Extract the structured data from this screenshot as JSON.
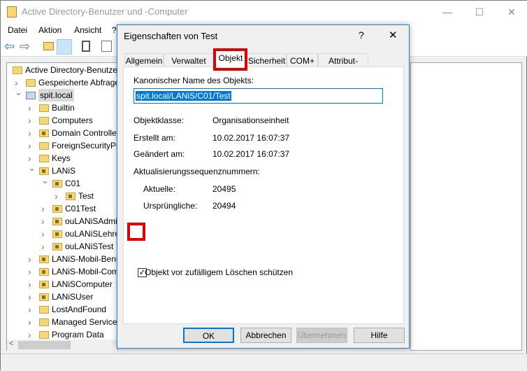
{
  "window": {
    "title": "Active Directory-Benutzer und -Computer",
    "minimize": "—",
    "maximize": "☐",
    "close": "✕"
  },
  "menu": [
    "Datei",
    "Aktion",
    "Ansicht",
    "?"
  ],
  "tree": [
    {
      "label": "Active Directory-Benutzer",
      "level": 0,
      "chev": "",
      "icon": "snapin"
    },
    {
      "label": "Gespeicherte Abfragen",
      "level": 1,
      "chev": ">",
      "icon": "folder"
    },
    {
      "label": "spit.local",
      "level": 1,
      "chev": "v",
      "icon": "domain"
    },
    {
      "label": "Builtin",
      "level": 2,
      "chev": ">",
      "icon": "folder"
    },
    {
      "label": "Computers",
      "level": 2,
      "chev": ">",
      "icon": "folder"
    },
    {
      "label": "Domain Controllers",
      "level": 2,
      "chev": ">",
      "icon": "ou"
    },
    {
      "label": "ForeignSecurityPrincipals",
      "level": 2,
      "chev": ">",
      "icon": "folder"
    },
    {
      "label": "Keys",
      "level": 2,
      "chev": ">",
      "icon": "folder"
    },
    {
      "label": "LANiS",
      "level": 2,
      "chev": "v",
      "icon": "ou"
    },
    {
      "label": "C01",
      "level": 3,
      "chev": "v",
      "icon": "ou"
    },
    {
      "label": "Test",
      "level": 4,
      "chev": ">",
      "icon": "ou"
    },
    {
      "label": "C01Test",
      "level": 3,
      "chev": ">",
      "icon": "ou"
    },
    {
      "label": "ouLANiSAdmin",
      "level": 3,
      "chev": ">",
      "icon": "ou"
    },
    {
      "label": "ouLANiSLehrer",
      "level": 3,
      "chev": ">",
      "icon": "ou"
    },
    {
      "label": "ouLANiSTest",
      "level": 3,
      "chev": ">",
      "icon": "ou"
    },
    {
      "label": "LANiS-Mobil-Benutzer",
      "level": 2,
      "chev": ">",
      "icon": "ou"
    },
    {
      "label": "LANiS-Mobil-Computer",
      "level": 2,
      "chev": ">",
      "icon": "ou"
    },
    {
      "label": "LANiSComputer",
      "level": 2,
      "chev": ">",
      "icon": "ou"
    },
    {
      "label": "LANiSUser",
      "level": 2,
      "chev": ">",
      "icon": "ou"
    },
    {
      "label": "LostAndFound",
      "level": 2,
      "chev": ">",
      "icon": "folder"
    },
    {
      "label": "Managed Service Accounts",
      "level": 2,
      "chev": ">",
      "icon": "folder"
    },
    {
      "label": "Program Data",
      "level": 2,
      "chev": ">",
      "icon": "folder"
    }
  ],
  "dialog": {
    "title": "Eigenschaften von Test",
    "help": "?",
    "close": "✕",
    "tabs": [
      "Allgemein",
      "Verwaltet von",
      "Objekt",
      "Sicherheit",
      "COM+",
      "Attribut-Editor"
    ],
    "selected_tab": "Objekt",
    "canonical_label": "Kanonischer Name des Objekts:",
    "canonical_value": "spit.local/LANiS/C01/Test",
    "objektklasse_label": "Objektklasse:",
    "objektklasse": "Organisationseinheit",
    "erstellt_label": "Erstellt am:",
    "erstellt": "10.02.2017 16:07:37",
    "geaendert_label": "Geändert am:",
    "geaendert": "10.02.2017 16:07:37",
    "usn_label": "Aktualisierungssequenznummern:",
    "aktuelle_label": "Aktuelle:",
    "aktuelle": "20495",
    "urspr_label": "Ursprüngliche:",
    "urspr": "20494",
    "protect_label": "Objekt vor zufälligem Löschen schützen",
    "protect_checked": true,
    "buttons": {
      "ok": "OK",
      "cancel": "Abbrechen",
      "apply": "Übernehmen",
      "help": "Hilfe"
    },
    "highlight_color": "#e00000"
  }
}
